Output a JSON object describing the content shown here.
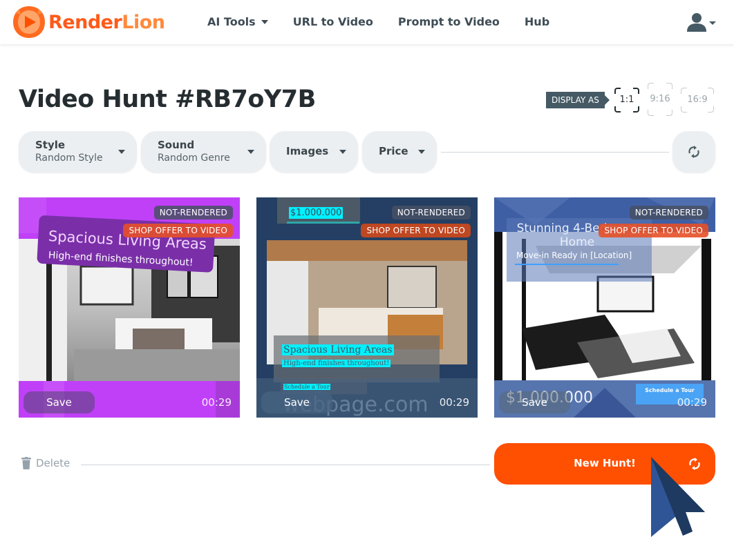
{
  "header": {
    "logo": {
      "word1": "Render",
      "word2": "Lion"
    },
    "nav": [
      {
        "label": "AI Tools",
        "has_dropdown": true
      },
      {
        "label": "URL to Video"
      },
      {
        "label": "Prompt to Video"
      },
      {
        "label": "Hub"
      }
    ],
    "user_icon": "user-icon"
  },
  "page": {
    "title": "Video Hunt #RB7oY7B",
    "display_as_label": "DISPLAY AS",
    "ratios": [
      {
        "label": "1:1",
        "active": true
      },
      {
        "label": "9:16",
        "active": false
      },
      {
        "label": "16:9",
        "active": false
      }
    ]
  },
  "filters": [
    {
      "label": "Style",
      "value": "Random Style"
    },
    {
      "label": "Sound",
      "value": "Random Genre"
    },
    {
      "label": "Images"
    },
    {
      "label": "Price"
    }
  ],
  "cards": [
    {
      "status": "NOT-RENDERED",
      "shop_label": "SHOP OFFER TO VIDEO",
      "headline": "Spacious Living Areas",
      "subline": "High-end finishes throughout!",
      "save_label": "Save",
      "duration": "00:29",
      "theme_color": "#c040f8"
    },
    {
      "status": "NOT-RENDERED",
      "shop_label": "SHOP OFFER TO VIDEO",
      "price": "$1.000.000",
      "headline": "Spacious Living Areas",
      "subline": "High-end finishes throughout!",
      "cta": "Schedule a Tour",
      "watermark": "webpage.com",
      "save_label": "Save",
      "duration": "00:29",
      "theme_color": "#243f63"
    },
    {
      "status": "NOT-RENDERED",
      "shop_label": "SHOP OFFER TO VIDEO",
      "headline": "Stunning 4-Bedroom Home",
      "subline": "Move-in Ready in [Location]",
      "price": "$1.000.000",
      "cta": "Schedule a Tour",
      "save_label": "Save",
      "duration": "00:29",
      "theme_color": "#3f5fa5"
    }
  ],
  "footer": {
    "delete_label": "Delete",
    "new_hunt_label": "New Hunt!"
  },
  "colors": {
    "brand_orange": "#ff4f00",
    "text_dark": "#262d31",
    "chip_bg": "#eceff1"
  }
}
